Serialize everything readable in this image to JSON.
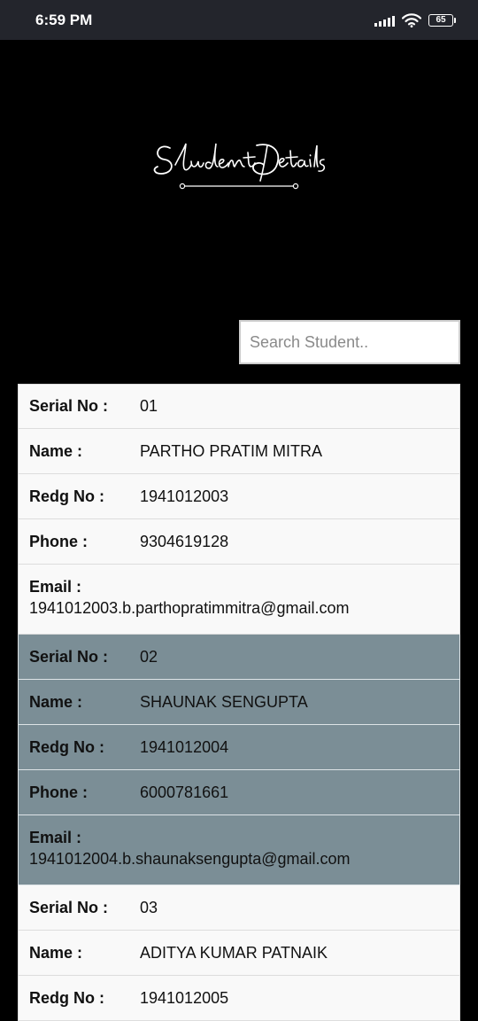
{
  "status_bar": {
    "time": "6:59 PM",
    "battery": "65",
    "icons": [
      "signal-icon",
      "wifi-icon",
      "battery-icon"
    ]
  },
  "header": {
    "logo_text": "Student Details"
  },
  "search": {
    "placeholder": "Search Student..",
    "value": ""
  },
  "labels": {
    "serial": "Serial No :",
    "name": "Name :",
    "redg": "Redg No :",
    "phone": "Phone :",
    "email": "Email :"
  },
  "students": [
    {
      "serial": "01",
      "name": "PARTHO PRATIM MITRA",
      "redg": "1941012003",
      "phone": "9304619128",
      "email": "1941012003.b.parthopratimmitra@gmail.com"
    },
    {
      "serial": "02",
      "name": "SHAUNAK SENGUPTA",
      "redg": "1941012004",
      "phone": "6000781661",
      "email": "1941012004.b.shaunaksengupta@gmail.com"
    },
    {
      "serial": "03",
      "name": "ADITYA KUMAR PATNAIK",
      "redg": "1941012005",
      "phone": "",
      "email": ""
    }
  ],
  "colors": {
    "page_background": "#000000",
    "status_bar": "#23252c",
    "row_light": "#f9f9f9",
    "row_dark": "#7b8e96"
  }
}
